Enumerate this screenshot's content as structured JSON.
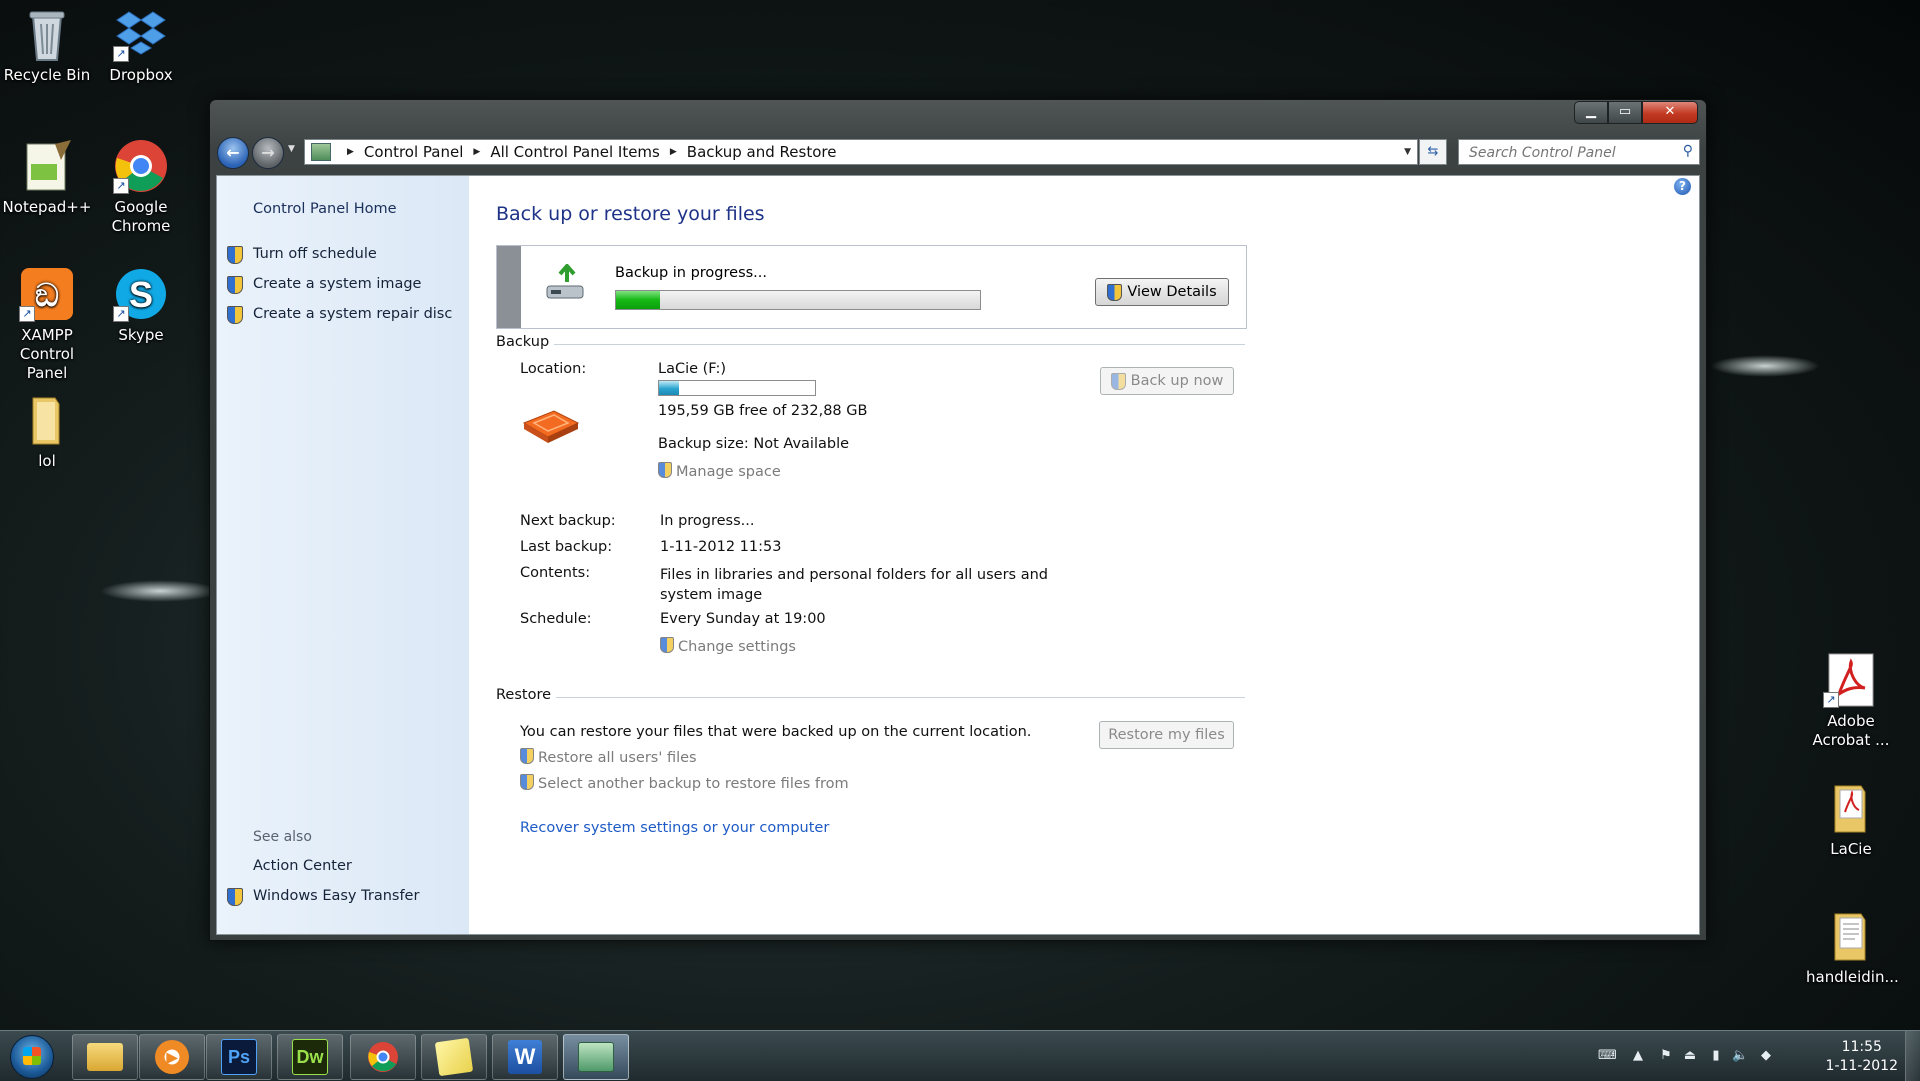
{
  "desktop": {
    "icons": [
      {
        "label": "Recycle Bin",
        "icon": "recycle-bin-icon"
      },
      {
        "label": "Dropbox",
        "icon": "dropbox-icon"
      },
      {
        "label": "Notepad++",
        "icon": "notepad-plus-plus-icon"
      },
      {
        "label": "Google Chrome",
        "icon": "chrome-icon"
      },
      {
        "label": "XAMPP Control Panel",
        "icon": "xampp-icon"
      },
      {
        "label": "Skype",
        "icon": "skype-icon"
      },
      {
        "label": "lol",
        "icon": "folder-icon"
      },
      {
        "label": "Adobe Acrobat ...",
        "icon": "acrobat-icon"
      },
      {
        "label": "LaCie",
        "icon": "lacie-folder-icon"
      },
      {
        "label": "handleidin...",
        "icon": "document-folder-icon"
      }
    ]
  },
  "window": {
    "address": {
      "crumbs": [
        "Control Panel",
        "All Control Panel Items",
        "Backup and Restore"
      ]
    },
    "search": {
      "placeholder": "Search Control Panel"
    },
    "sidebar": {
      "home": "Control Panel Home",
      "tasks": [
        "Turn off schedule",
        "Create a system image",
        "Create a system repair disc"
      ],
      "see_also_title": "See also",
      "see_also": [
        "Action Center",
        "Windows Easy Transfer"
      ]
    },
    "main": {
      "title": "Back up or restore your files",
      "progress": {
        "text": "Backup in progress...",
        "fraction": 0.12,
        "button": "View Details"
      },
      "backup": {
        "heading": "Backup",
        "location_label": "Location:",
        "location_value": "LaCie (F:)",
        "space_used_fraction": 0.13,
        "free_space": "195,59 GB free of 232,88 GB",
        "backup_size": "Backup size: Not Available",
        "manage_space": "Manage space",
        "back_up_now": "Back up now",
        "next_label": "Next backup:",
        "next_value": "In progress...",
        "last_label": "Last backup:",
        "last_value": "1-11-2012 11:53",
        "contents_label": "Contents:",
        "contents_value": "Files in libraries and personal folders for all users and system image",
        "schedule_label": "Schedule:",
        "schedule_value": "Every Sunday at 19:00",
        "change_settings": "Change settings"
      },
      "restore": {
        "heading": "Restore",
        "text": "You can restore your files that were backed up on the current location.",
        "restore_all": "Restore all users' files",
        "select_another": "Select another backup to restore files from",
        "restore_button": "Restore my files",
        "recover_link": "Recover system settings or your computer"
      }
    }
  },
  "taskbar": {
    "apps": [
      "windows-explorer-icon",
      "media-player-icon",
      "photoshop-icon",
      "dreamweaver-icon",
      "chrome-icon",
      "sticky-notes-icon",
      "word-icon",
      "control-panel-icon"
    ],
    "app_labels": {
      "photoshop": "Ps",
      "dreamweaver": "Dw",
      "word": "W"
    },
    "clock": {
      "time": "11:55",
      "date": "1-11-2012"
    }
  }
}
